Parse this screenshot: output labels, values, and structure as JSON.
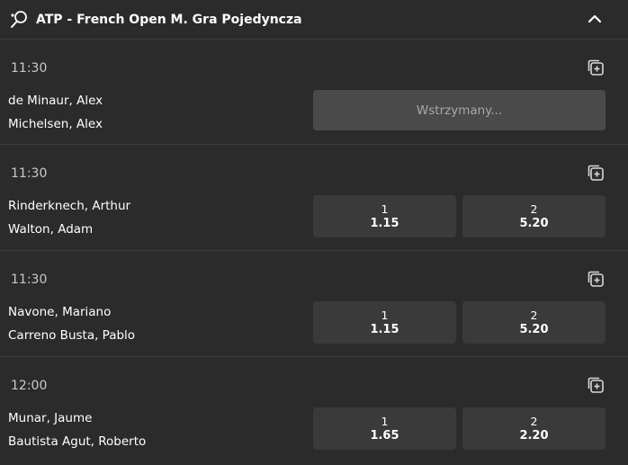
{
  "header": {
    "title": "ATP - French Open M. Gra Pojedyncza"
  },
  "matches": [
    {
      "time": "11:30",
      "player1": "de Minaur, Alex",
      "player2": "Michelsen, Alex",
      "status": "Wstrzymany..."
    },
    {
      "time": "11:30",
      "player1": "Rinderknech, Arthur",
      "player2": "Walton, Adam",
      "odds": [
        {
          "label": "1",
          "value": "1.15"
        },
        {
          "label": "2",
          "value": "5.20"
        }
      ]
    },
    {
      "time": "11:30",
      "player1": "Navone, Mariano",
      "player2": "Carreno Busta, Pablo",
      "odds": [
        {
          "label": "1",
          "value": "1.15"
        },
        {
          "label": "2",
          "value": "5.20"
        }
      ]
    },
    {
      "time": "12:00",
      "player1": "Munar, Jaume",
      "player2": "Bautista Agut, Roberto",
      "odds": [
        {
          "label": "1",
          "value": "1.65"
        },
        {
          "label": "2",
          "value": "2.20"
        }
      ]
    }
  ],
  "icons": {
    "sport": "tennis-racket-icon",
    "collapse": "chevron-up-icon",
    "add": "add-to-betslip-icon"
  }
}
